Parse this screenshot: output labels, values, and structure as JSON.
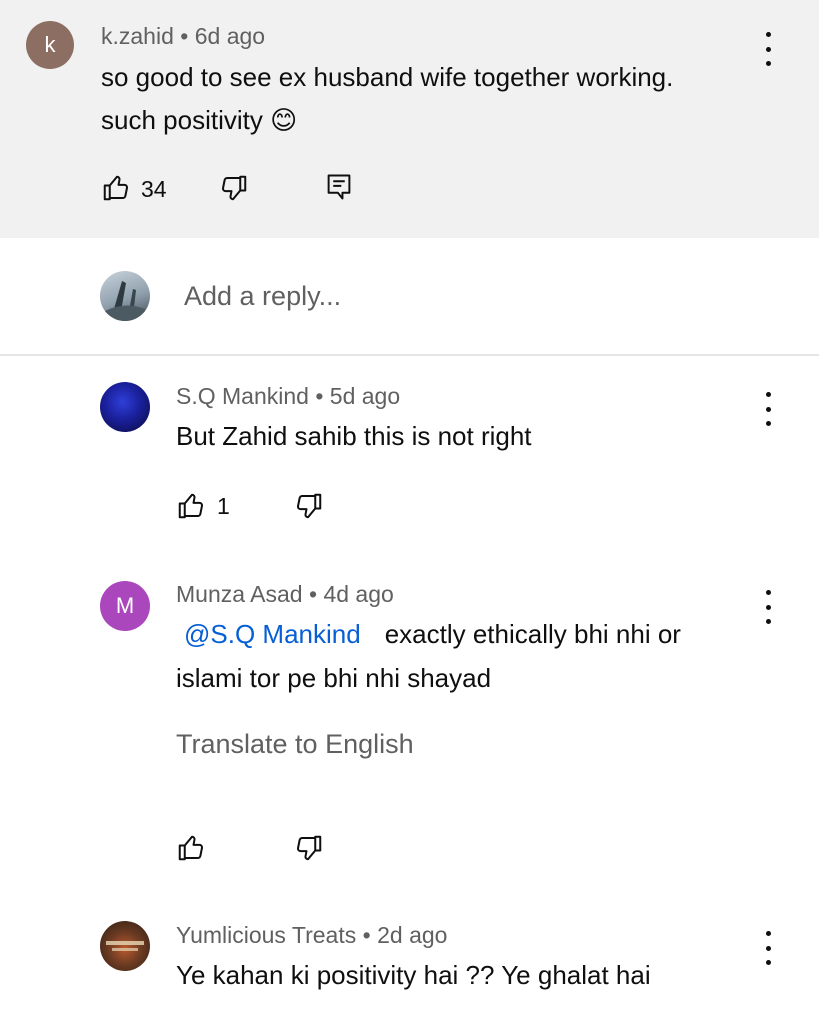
{
  "top_comment": {
    "avatar_letter": "k",
    "author": "k.zahid",
    "time": "6d ago",
    "line1": "so good to see ex husband wife together working.",
    "line2": "such positivity",
    "emoji": "😊",
    "likes": "34"
  },
  "reply_box": {
    "placeholder": "Add a reply..."
  },
  "replies": [
    {
      "author": "S.Q Mankind",
      "time": "5d ago",
      "text": "But Zahid sahib this is not right",
      "likes": "1"
    },
    {
      "avatar_letter": "M",
      "author": "Munza Asad",
      "time": "4d ago",
      "mention": "@S.Q Mankind",
      "line1": "exactly ethically bhi nhi or",
      "line2": "islami tor pe bhi nhi shayad",
      "translate": "Translate to English"
    },
    {
      "author": "Yumlicious Treats",
      "time": "2d ago",
      "text": "Ye kahan ki positivity hai ?? Ye ghalat hai"
    }
  ],
  "separator": "•",
  "colors": {
    "avatar_k": "#8d6e63",
    "avatar_m": "#ab47bc",
    "mention": "#065fd4"
  },
  "icons": [
    "like-icon",
    "dislike-icon",
    "reply-icon",
    "more-vert-icon"
  ]
}
